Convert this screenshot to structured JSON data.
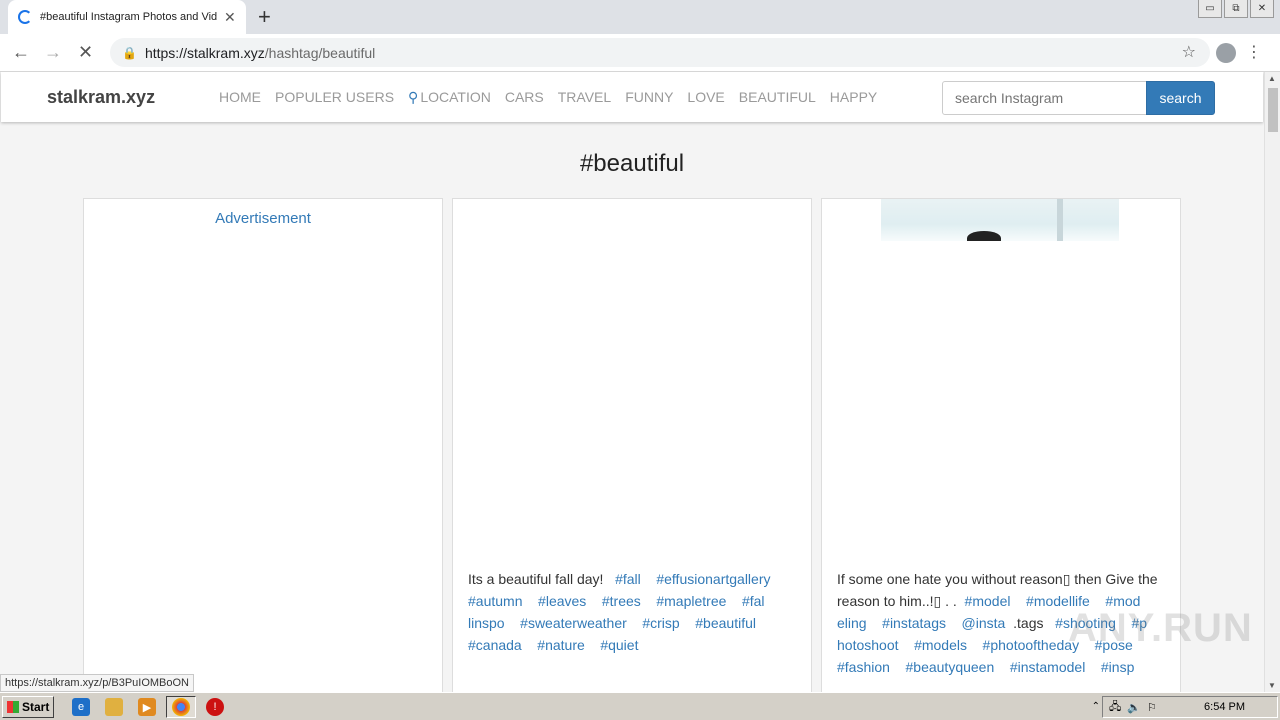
{
  "browser": {
    "tab_title": "#beautiful Instagram Photos and Vid",
    "tab_close": "✕",
    "new_tab": "+",
    "window_controls": [
      "▭",
      "⧉",
      "✕"
    ],
    "back": "←",
    "forward": "→",
    "reload": "✕",
    "url_host": "https://stalkram.xyz",
    "url_path": "/hashtag/beautiful",
    "star": "☆",
    "menu": "⋮",
    "status_url": "https://stalkram.xyz/p/B3PuIOMBoON"
  },
  "site": {
    "brand": "stalkram.xyz",
    "menu": [
      "HOME",
      "POPULER USERS",
      "LOCATION",
      "CARS",
      "TRAVEL",
      "FUNNY",
      "LOVE",
      "BEAUTIFUL",
      "HAPPY"
    ],
    "search_placeholder": "search Instagram",
    "search_button": "search",
    "heading": "#beautiful"
  },
  "cards": {
    "ad_label": "Advertisement",
    "post1": {
      "text": "Its a beautiful fall day!",
      "tags": [
        "#fall",
        "#effusionartgallery",
        "#autumn",
        "#leaves",
        "#trees",
        "#mapletree",
        "#fal linspo",
        "#sweaterweather",
        "#crisp",
        "#beautiful",
        "#canada",
        "#nature",
        "#quiet"
      ]
    },
    "post2": {
      "text": "If some one hate you without reason▯ then Give the reason to him..!▯ . .",
      "tags": [
        "#model",
        "#modellife",
        "#mod eling",
        "#instatags",
        "@insta",
        ".tags",
        "#shooting",
        "#p hotoshoot",
        "#models",
        "#photooftheday",
        "#pose",
        "#fashion",
        "#beautyqueen",
        "#instamodel",
        "#insp"
      ]
    }
  },
  "watermark": "ANY.RUN",
  "taskbar": {
    "start": "Start",
    "clock": "6:54 PM"
  }
}
